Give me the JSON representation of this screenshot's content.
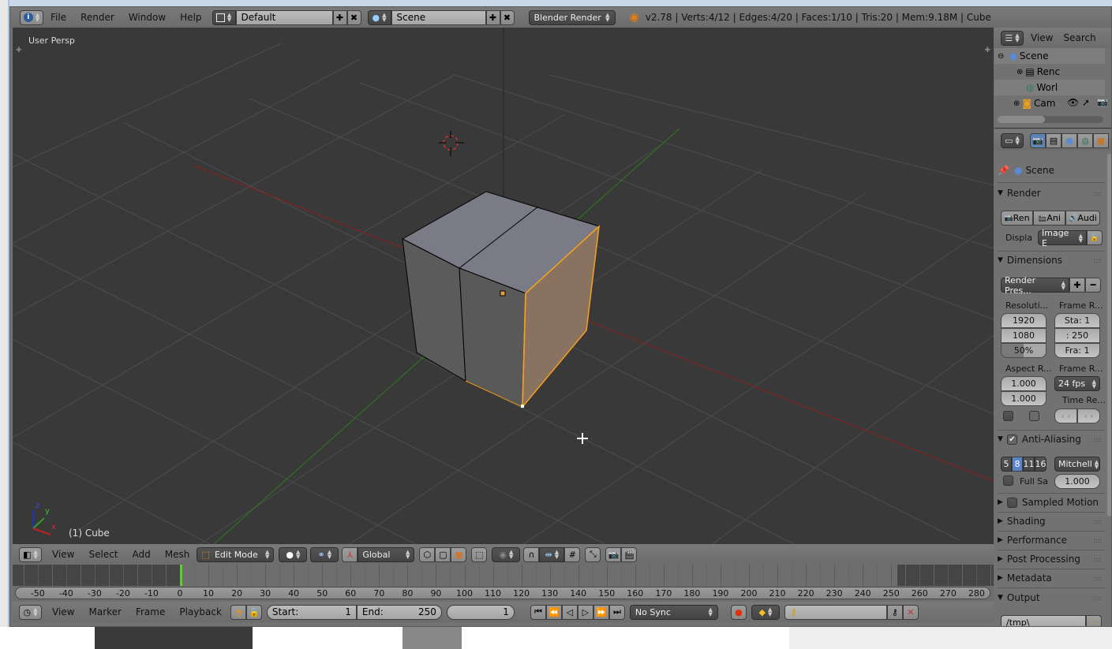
{
  "top_header": {
    "info_icon": "info-icon",
    "menus": [
      "File",
      "Render",
      "Window",
      "Help"
    ],
    "layout": {
      "icon": "screen-layout-icon",
      "value": "Default"
    },
    "scene": {
      "icon": "scene-icon",
      "value": "Scene"
    },
    "engine": "Blender Render",
    "stats": "v2.78 | Verts:4/12 | Edges:4/20 | Faces:1/10 | Tris:20 | Mem:9.18M | Cube"
  },
  "viewport": {
    "view_label": "User Persp",
    "object_label": "(1) Cube",
    "axis": {
      "x": "x",
      "y": "y",
      "z": "z"
    },
    "colors": {
      "x_axis": "#a02020",
      "y_axis": "#3a8a20",
      "selection": "#f5a11e",
      "grid": "#4d4d4d"
    }
  },
  "viewport_header": {
    "menus": [
      "View",
      "Select",
      "Add",
      "Mesh"
    ],
    "mode": "Edit Mode",
    "orientation": "Global"
  },
  "timeline": {
    "ticks": [
      "-50",
      "-40",
      "-30",
      "-20",
      "-10",
      "0",
      "10",
      "20",
      "30",
      "40",
      "50",
      "60",
      "70",
      "80",
      "90",
      "100",
      "110",
      "120",
      "130",
      "140",
      "150",
      "160",
      "170",
      "180",
      "190",
      "200",
      "210",
      "220",
      "230",
      "240",
      "250",
      "260",
      "270",
      "280"
    ],
    "current_frame_marker": 0,
    "menus": [
      "View",
      "Marker",
      "Frame",
      "Playback"
    ],
    "start_label": "Start:",
    "start_value": "1",
    "end_label": "End:",
    "end_value": "250",
    "current_frame": "1",
    "sync": "No Sync"
  },
  "outliner": {
    "menus": [
      "View",
      "Search"
    ],
    "items": [
      {
        "label": "Scene",
        "icon": "scene-icon"
      },
      {
        "label": "Renc",
        "icon": "render-layers-icon"
      },
      {
        "label": "Worl",
        "icon": "world-icon"
      },
      {
        "label": "Cam",
        "icon": "camera-icon"
      }
    ]
  },
  "properties": {
    "context": "Scene",
    "render": {
      "title": "Render",
      "buttons": [
        "Ren",
        "Ani",
        "Audi"
      ],
      "display_label": "Displa",
      "display_value": "Image E"
    },
    "dimensions": {
      "title": "Dimensions",
      "preset": "Render Pres...",
      "resolution_label": "Resoluti...",
      "res_x": "1920",
      "res_y": "1080",
      "res_pct": "50%",
      "frame_range_label": "Frame R...",
      "start": "Sta: 1",
      "end": ": 250",
      "step": "Fra: 1",
      "aspect_label": "Aspect R...",
      "aspect_x": "1.000",
      "aspect_y": "1.000",
      "frame_rate_label": "Frame R...",
      "fps": "24 fps",
      "time_remap_label": "Time Re..."
    },
    "anti_aliasing": {
      "title": "Anti-Aliasing",
      "samples": [
        "5",
        "8",
        "11",
        "16"
      ],
      "selected": "8",
      "filter": "Mitchell",
      "full_sample": "Full Sa",
      "size": "1.000"
    },
    "collapsed_panels": [
      "Sampled Motion",
      "Shading",
      "Performance",
      "Post Processing",
      "Metadata"
    ],
    "output": {
      "title": "Output",
      "path": "/tmp\\"
    }
  }
}
